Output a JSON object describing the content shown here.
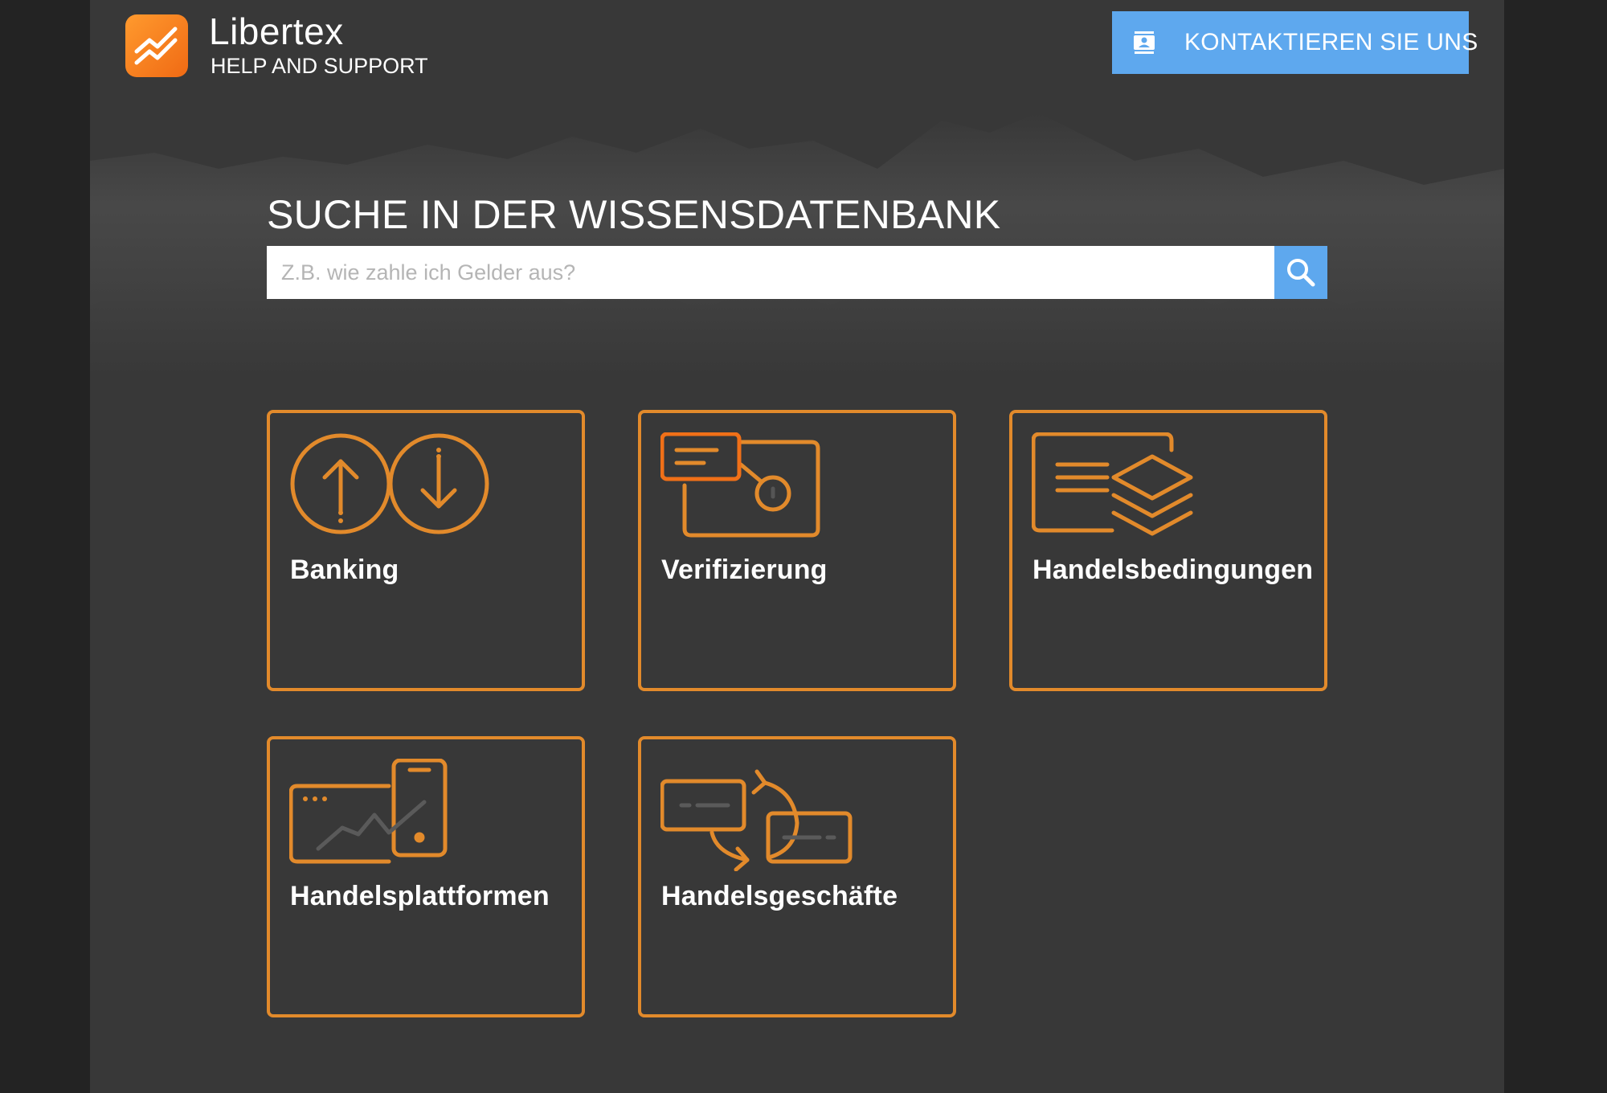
{
  "header": {
    "brand_name": "Libertex",
    "brand_subtitle": "HELP AND SUPPORT",
    "contact_label": "KONTAKTIEREN SIE UNS",
    "contact_icon": "contact-card-icon"
  },
  "search": {
    "title": "SUCHE IN DER WISSENSDATENBANK",
    "placeholder": "Z.B. wie zahle ich Gelder aus?",
    "value": "",
    "button_icon": "search-icon"
  },
  "categories": [
    {
      "label": "Banking",
      "icon": "deposit-withdraw-icon"
    },
    {
      "label": "Verifizierung",
      "icon": "id-card-verification-icon"
    },
    {
      "label": "Handelsbedingungen",
      "icon": "document-layers-icon"
    },
    {
      "label": "Handelsplattformen",
      "icon": "desktop-mobile-chart-icon"
    },
    {
      "label": "Handelsgeschäfte",
      "icon": "exchange-cards-icon"
    }
  ],
  "colors": {
    "background": "#383838",
    "accent_orange": "#e28a2b",
    "button_blue": "#5ea8ee",
    "text": "#ffffff"
  }
}
